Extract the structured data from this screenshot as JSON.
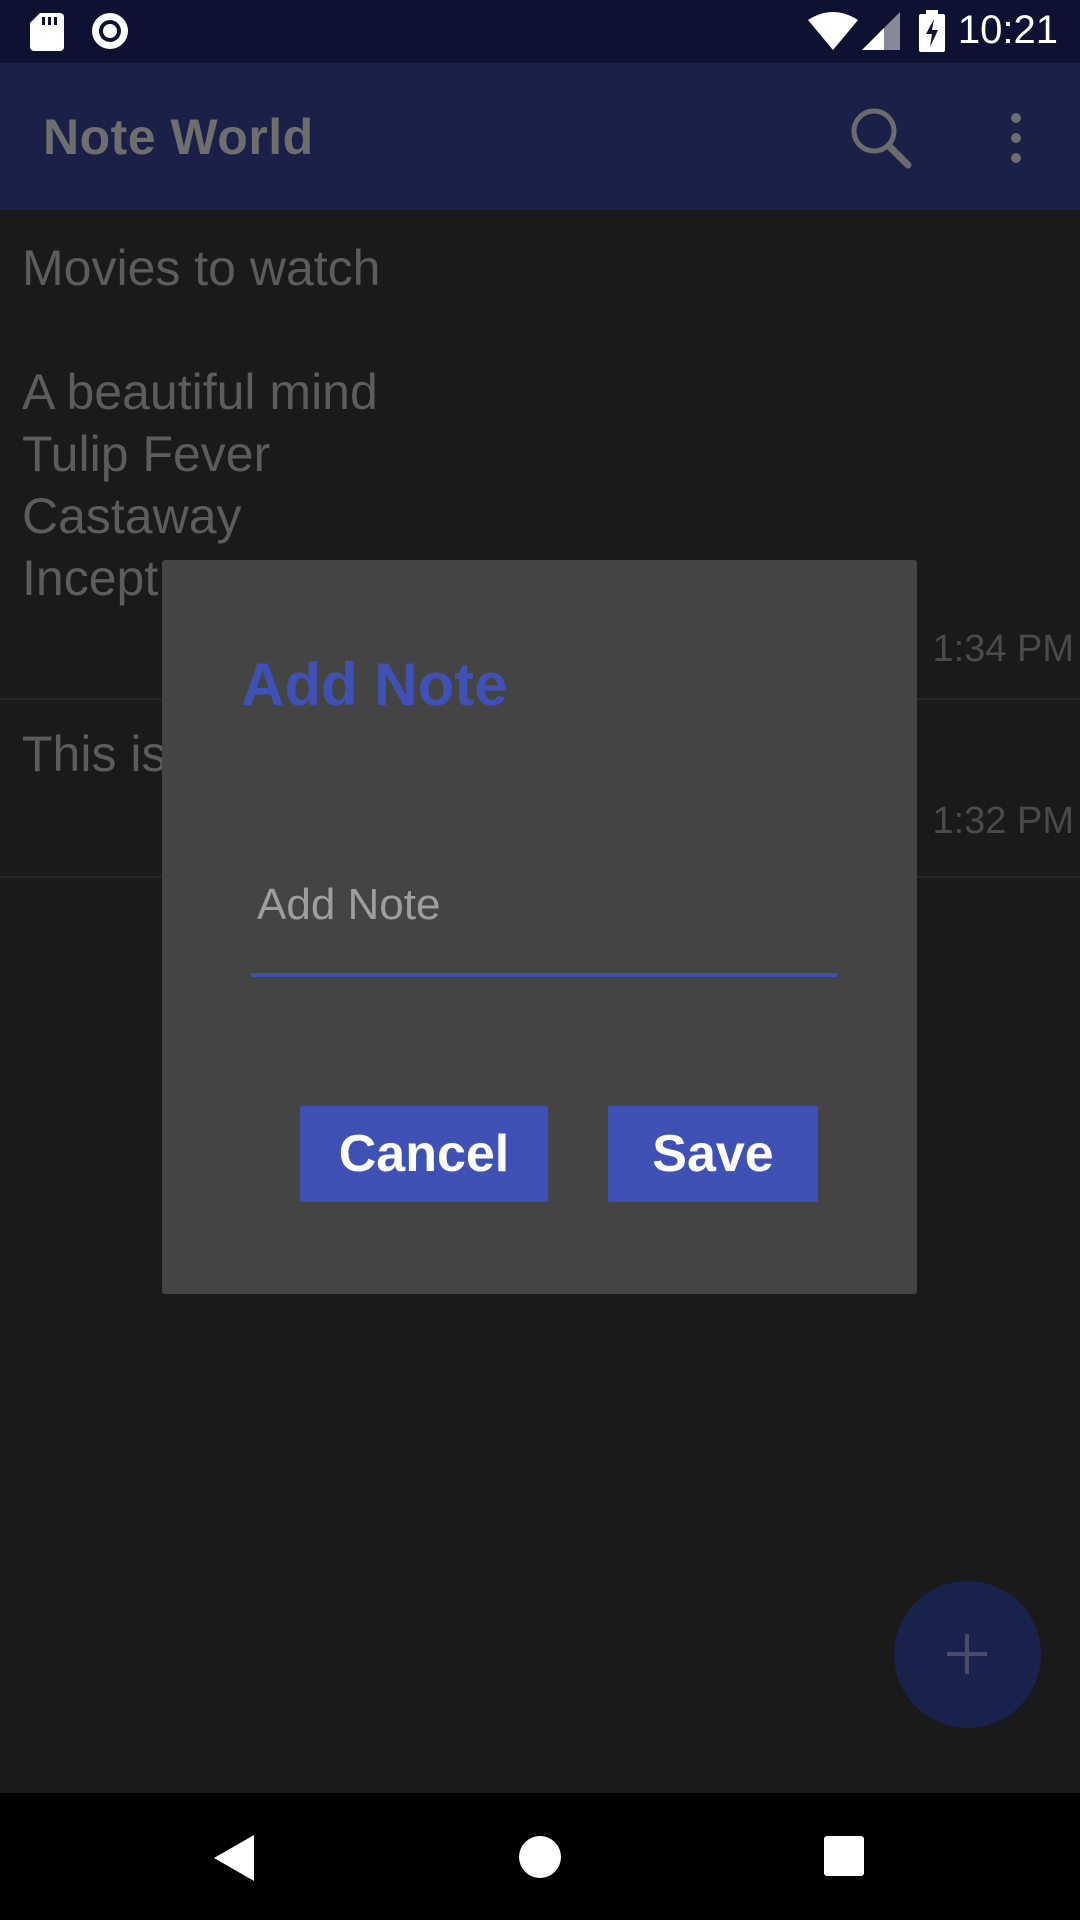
{
  "status_bar": {
    "time": "10:21",
    "icons": [
      "sd-card-icon",
      "sync-icon",
      "wifi-icon",
      "signal-icon",
      "battery-charging-icon"
    ]
  },
  "toolbar": {
    "title": "Note World",
    "icons": [
      "search-icon",
      "more-vert-icon"
    ]
  },
  "notes": [
    {
      "text": "Movies to watch\n\nA beautiful mind\nTulip Fever\nCastaway\nIncept",
      "time": "1:34 PM"
    },
    {
      "text": "This is",
      "time": "1:32 PM"
    }
  ],
  "dialog": {
    "title": "Add Note",
    "input_placeholder": "Add Note",
    "input_value": "",
    "cancel_label": "Cancel",
    "save_label": "Save"
  },
  "fab": {
    "icon": "plus-icon"
  },
  "nav_bar": {
    "icons": [
      "back-icon",
      "home-icon",
      "recents-icon"
    ]
  },
  "colors": {
    "accent": "#3f51b5",
    "toolbar": "#1a2048",
    "status": "#0d1233",
    "dialog": "#444444"
  }
}
